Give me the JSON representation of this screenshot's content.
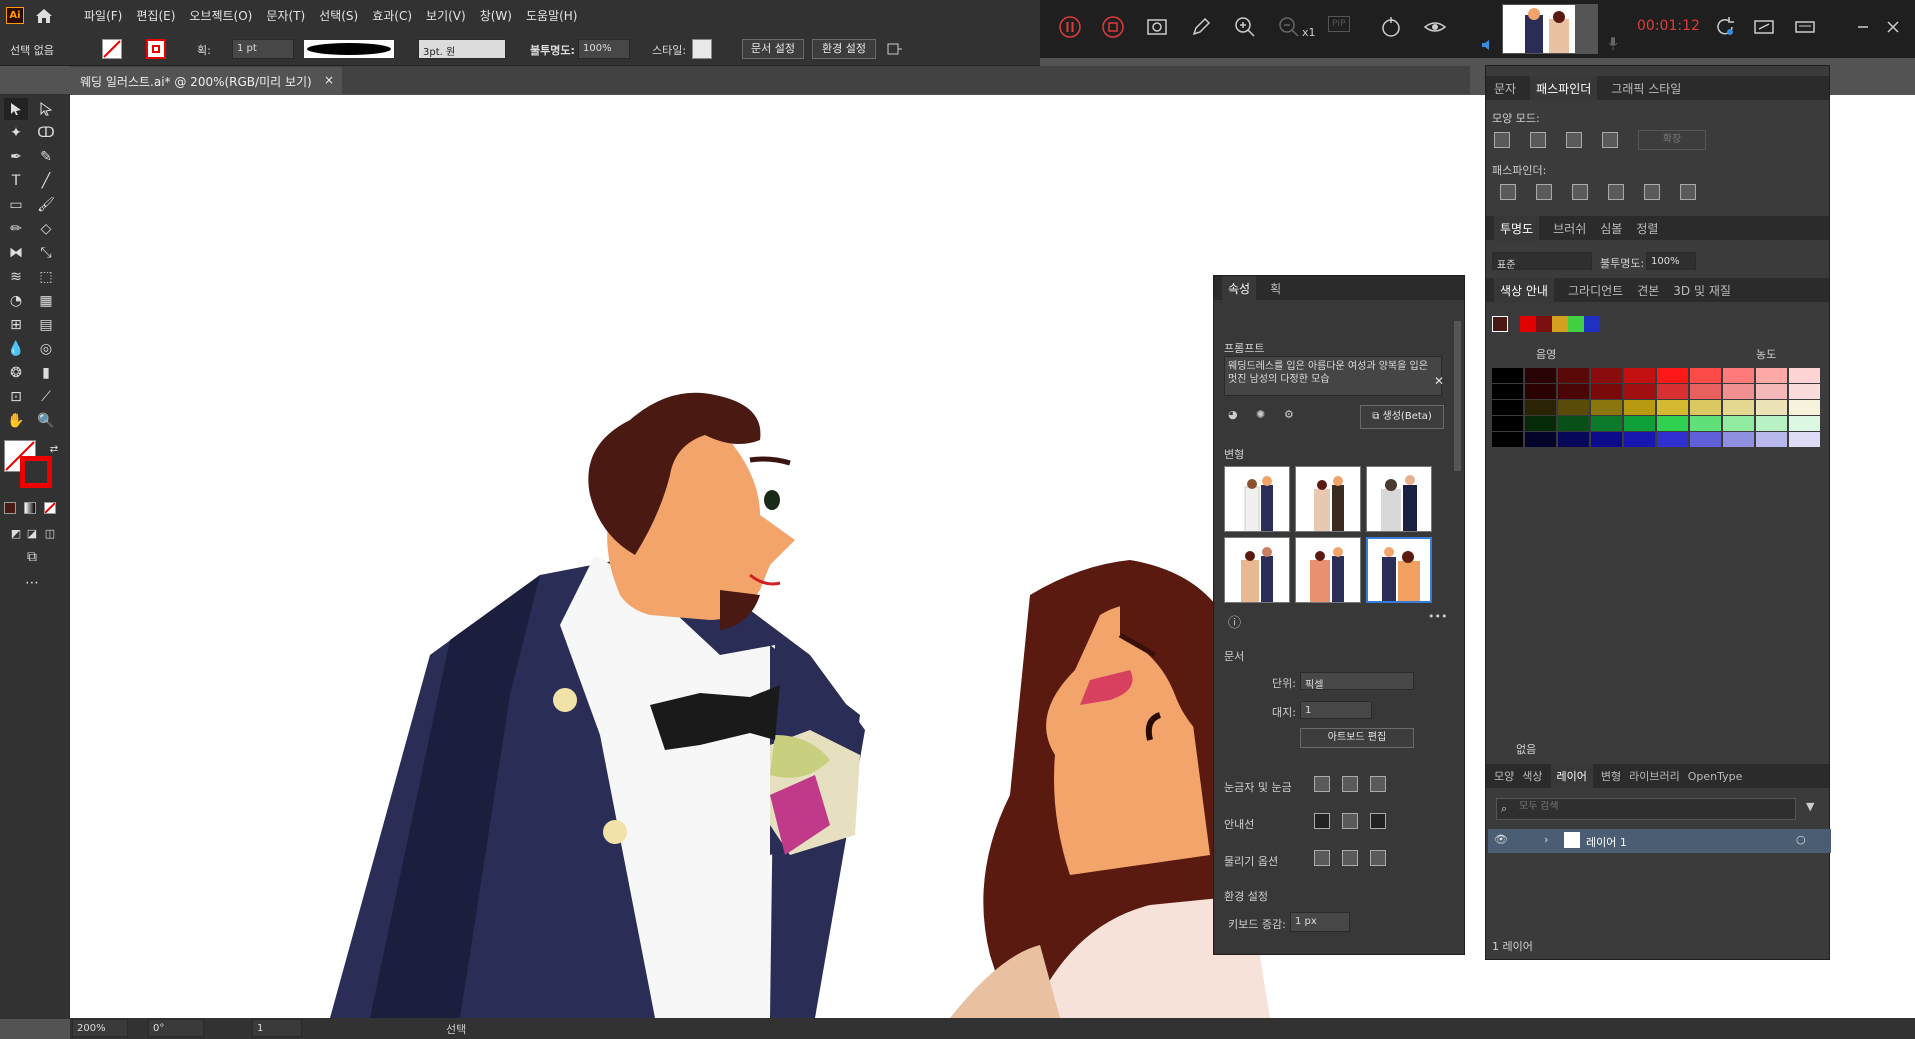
{
  "app": {
    "logo": "Ai",
    "menu": [
      "파일(F)",
      "편집(E)",
      "오브젝트(O)",
      "문자(T)",
      "선택(S)",
      "효과(C)",
      "보기(V)",
      "창(W)",
      "도움말(H)"
    ]
  },
  "recorder": {
    "time": "00:01:12",
    "speed": "x1",
    "pip_label": "PIP"
  },
  "options_bar": {
    "selection_label": "선택 없음",
    "stroke_label": "획:",
    "stroke_value": "1 pt",
    "brush_value": "3pt. 원",
    "opacity_label": "불투명도:",
    "opacity_value": "100%",
    "style_label": "스타일:",
    "doc_setup_button": "문서 설정",
    "prefs_button": "환경 설정"
  },
  "document_tab": {
    "title": "웨딩 일러스트.ai* @ 200%(RGB/미리 보기)",
    "close": "×"
  },
  "status_bar": {
    "zoom": "200%",
    "rotation": "0°",
    "artboard": "1",
    "tool": "선택"
  },
  "properties_panel": {
    "tabs": [
      "속성",
      "획"
    ],
    "prompt_label": "프롬프트",
    "prompt_text": "웨딩드레스를 입은 아름다운 여성과 양복을 입은 멋진 남성의 다정한 모습",
    "generate_button": "생성(Beta)",
    "variations_label": "변형",
    "document_section": "문서",
    "units_label": "단위:",
    "units_value": "픽셀",
    "artboard_label": "대지:",
    "artboard_value": "1",
    "edit_artboard_button": "아트보드 편집",
    "rulers_label": "눈금자 및 눈금",
    "guides_label": "안내선",
    "snap_label": "물리기 옵션",
    "prefs_section": "환경 설정",
    "keyboard_inc_label": "키보드 증감:",
    "keyboard_inc_value": "1 px"
  },
  "pathfinder_panel": {
    "tabs": [
      "문자",
      "패스파인더",
      "그래픽 스타일"
    ],
    "shape_modes_label": "모양 모드:",
    "expand_button": "확장",
    "pathfinders_label": "패스파인더:"
  },
  "transparency_panel": {
    "tabs": [
      "투명도",
      "브러쉬",
      "심볼",
      "정렬"
    ],
    "blend_mode": "표준",
    "opacity_label": "불투명도:",
    "opacity_value": "100%"
  },
  "color_guide_panel": {
    "tabs": [
      "색상 안내",
      "그라디언트",
      "견본",
      "3D 및 재질"
    ],
    "shade_label": "음영",
    "tint_label": "농도",
    "footer_label": "없음",
    "harmony_colors": [
      "#e00000",
      "#7a1010",
      "#d4a020",
      "#40d040",
      "#2030c0"
    ],
    "grid_colors": [
      [
        "#000000",
        "#2a0404",
        "#5a0808",
        "#8a0c0c",
        "#c41010",
        "#ff1818",
        "#ff4a4a",
        "#ff7a7a",
        "#ffa8a8",
        "#ffd4d4"
      ],
      [
        "#000000",
        "#2a0202",
        "#4a0606",
        "#7a0a0a",
        "#a01010",
        "#d83030",
        "#e86060",
        "#f09090",
        "#f5b8b8",
        "#fadcdc"
      ],
      [
        "#000000",
        "#2a2404",
        "#5a4c08",
        "#8a760c",
        "#b89a10",
        "#d4b830",
        "#dcc860",
        "#e4d890",
        "#ece4b8",
        "#f6f2dc"
      ],
      [
        "#000000",
        "#042a08",
        "#08501a",
        "#0c7a2a",
        "#10a03a",
        "#30d050",
        "#60e078",
        "#90eaa0",
        "#b8f2c4",
        "#dcf8e2"
      ],
      [
        "#000000",
        "#04042a",
        "#08085a",
        "#0c0c8a",
        "#1818b0",
        "#3030d0",
        "#6060d8",
        "#9090e0",
        "#b8b8ec",
        "#dcdcf6"
      ]
    ]
  },
  "layers_panel": {
    "tabs": [
      "모양",
      "색상",
      "레이어",
      "변형",
      "라이브러리",
      "OpenType"
    ],
    "search_placeholder": "모두 검색",
    "layer_name": "레이어 1",
    "footer": "1 레이어"
  },
  "colors": {
    "suit": "#2a2d55",
    "suit_dark": "#1c1e3d",
    "skin": "#f3a46a",
    "hair_man": "#4a1a12",
    "hair_woman": "#5a1a10",
    "bowtie": "#1a1a1a",
    "button": "#f2e2a8",
    "lips": "#d84060"
  }
}
